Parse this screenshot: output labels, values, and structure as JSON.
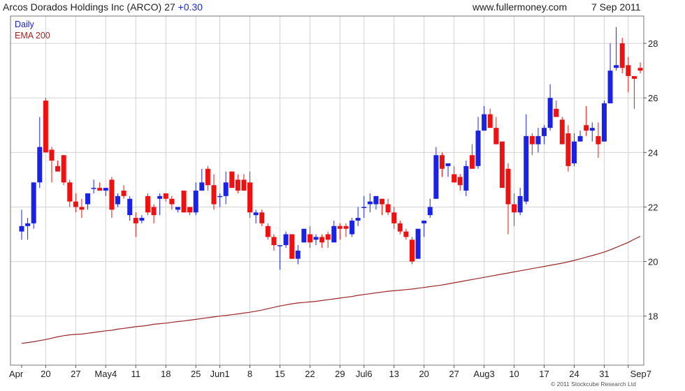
{
  "header": {
    "title": "Arcos Dorados Holdings Inc (ARCO) 27",
    "change": "+0.30",
    "website": "www.fullermoney.com",
    "date": "7 Sep 2011"
  },
  "legend": {
    "daily": "Daily",
    "ema": "EMA 200"
  },
  "copyright": "© 2011 Stockcube Research Ltd",
  "colors": {
    "up": "#1a22e6",
    "down": "#ee1111",
    "ema": "#9c2626",
    "grid": "#d2d2d2",
    "axis": "#555555"
  },
  "chart_data": {
    "type": "candlestick",
    "ylim": [
      16.2,
      29.0
    ],
    "yticks": [
      18,
      20,
      22,
      24,
      26,
      28
    ],
    "grid": true,
    "legend_position": "top-left",
    "x_tick_labels": [
      "Apr",
      "20",
      "27",
      "May4",
      "11",
      "18",
      "25",
      "Jun1",
      "8",
      "15",
      "22",
      "29",
      "Jul6",
      "13",
      "20",
      "27",
      "Aug3",
      "10",
      "17",
      "24",
      "31",
      "Sep7"
    ],
    "dates": [
      "Apr 14",
      "Apr 15",
      "Apr 18",
      "Apr 19",
      "Apr 20",
      "Apr 21",
      "Apr 22",
      "Apr 25",
      "Apr 26",
      "Apr 27",
      "Apr 28",
      "Apr 29",
      "May 2",
      "May 3",
      "May 4",
      "May 5",
      "May 6",
      "May 9",
      "May 10",
      "May 11",
      "May 12",
      "May 13",
      "May 16",
      "May 17",
      "May 18",
      "May 19",
      "May 20",
      "May 23",
      "May 24",
      "May 25",
      "May 26",
      "May 27",
      "May 31",
      "Jun 1",
      "Jun 2",
      "Jun 3",
      "Jun 6",
      "Jun 7",
      "Jun 8",
      "Jun 9",
      "Jun 10",
      "Jun 13",
      "Jun 14",
      "Jun 15",
      "Jun 16",
      "Jun 17",
      "Jun 20",
      "Jun 21",
      "Jun 22",
      "Jun 23",
      "Jun 24",
      "Jun 27",
      "Jun 28",
      "Jun 29",
      "Jun 30",
      "Jul 1",
      "Jul 5",
      "Jul 6",
      "Jul 7",
      "Jul 8",
      "Jul 11",
      "Jul 12",
      "Jul 13",
      "Jul 14",
      "Jul 15",
      "Jul 18",
      "Jul 19",
      "Jul 20",
      "Jul 21",
      "Jul 22",
      "Jul 25",
      "Jul 26",
      "Jul 27",
      "Jul 28",
      "Jul 29",
      "Aug 1",
      "Aug 2",
      "Aug 3",
      "Aug 4",
      "Aug 5",
      "Aug 8",
      "Aug 9",
      "Aug 10",
      "Aug 11",
      "Aug 12",
      "Aug 15",
      "Aug 16",
      "Aug 17",
      "Aug 18",
      "Aug 19",
      "Aug 22",
      "Aug 23",
      "Aug 24",
      "Aug 25",
      "Aug 26",
      "Aug 29",
      "Aug 30",
      "Aug 31",
      "Sep 1",
      "Sep 2",
      "Sep 6",
      "Sep 7"
    ],
    "ohlc": [
      [
        21.1,
        21.9,
        20.8,
        21.3
      ],
      [
        21.3,
        21.6,
        20.8,
        21.4
      ],
      [
        21.4,
        22.9,
        21.2,
        22.9
      ],
      [
        22.9,
        25.3,
        22.7,
        24.2
      ],
      [
        25.9,
        26.0,
        24.0,
        24.0
      ],
      [
        24.1,
        24.2,
        22.9,
        23.7
      ],
      [
        23.5,
        23.7,
        23.3,
        23.3
      ],
      [
        23.9,
        23.9,
        22.8,
        22.9
      ],
      [
        22.9,
        23.0,
        22.0,
        22.2
      ],
      [
        22.2,
        22.5,
        21.8,
        22.0
      ],
      [
        22.0,
        22.3,
        21.6,
        21.9
      ],
      [
        22.1,
        22.5,
        21.9,
        22.5
      ],
      [
        22.7,
        23.0,
        22.5,
        22.7
      ],
      [
        22.7,
        22.9,
        22.6,
        22.6
      ],
      [
        22.6,
        22.7,
        22.4,
        22.7
      ],
      [
        23.0,
        23.1,
        21.6,
        21.9
      ],
      [
        22.1,
        22.5,
        22.0,
        22.4
      ],
      [
        22.6,
        22.8,
        22.3,
        22.4
      ],
      [
        21.7,
        22.4,
        21.5,
        22.3
      ],
      [
        21.6,
        21.8,
        20.9,
        21.4
      ],
      [
        21.5,
        21.7,
        21.4,
        21.6
      ],
      [
        22.4,
        22.5,
        21.7,
        21.8
      ],
      [
        22.0,
        22.1,
        21.4,
        21.7
      ],
      [
        22.3,
        22.5,
        21.7,
        22.4
      ],
      [
        22.5,
        22.5,
        22.2,
        22.3
      ],
      [
        22.3,
        22.4,
        21.9,
        22.1
      ],
      [
        21.9,
        22.0,
        21.8,
        22.0
      ],
      [
        22.6,
        22.6,
        21.8,
        21.8
      ],
      [
        22.0,
        22.0,
        21.7,
        21.8
      ],
      [
        21.8,
        22.9,
        21.7,
        22.6
      ],
      [
        22.6,
        23.4,
        22.6,
        22.9
      ],
      [
        23.4,
        23.5,
        22.6,
        22.8
      ],
      [
        22.8,
        23.2,
        21.9,
        22.1
      ],
      [
        22.4,
        22.5,
        22.0,
        22.4
      ],
      [
        22.4,
        23.3,
        22.1,
        22.9
      ],
      [
        23.3,
        23.3,
        22.7,
        22.7
      ],
      [
        23.0,
        23.2,
        22.5,
        22.6
      ],
      [
        23.0,
        23.2,
        22.6,
        22.6
      ],
      [
        22.9,
        23.3,
        21.6,
        21.8
      ],
      [
        21.7,
        21.9,
        21.4,
        21.8
      ],
      [
        21.8,
        21.9,
        21.3,
        21.4
      ],
      [
        21.3,
        21.4,
        20.8,
        20.9
      ],
      [
        20.9,
        21.0,
        20.4,
        20.6
      ],
      [
        20.6,
        20.6,
        19.7,
        20.6
      ],
      [
        20.6,
        21.1,
        20.5,
        21.0
      ],
      [
        21.0,
        21.0,
        20.1,
        20.1
      ],
      [
        20.1,
        20.6,
        19.9,
        20.4
      ],
      [
        20.7,
        21.2,
        20.7,
        21.2
      ],
      [
        21.0,
        21.3,
        20.5,
        20.7
      ],
      [
        20.8,
        21.0,
        20.6,
        20.9
      ],
      [
        20.9,
        21.0,
        20.5,
        20.7
      ],
      [
        21.0,
        21.1,
        20.5,
        20.8
      ],
      [
        20.7,
        21.5,
        20.7,
        21.3
      ],
      [
        21.3,
        21.4,
        20.8,
        21.2
      ],
      [
        21.3,
        21.4,
        20.9,
        21.2
      ],
      [
        21.0,
        21.6,
        20.9,
        21.5
      ],
      [
        21.5,
        22.0,
        21.3,
        21.6
      ],
      [
        22.0,
        22.4,
        21.6,
        22.0
      ],
      [
        22.1,
        22.5,
        21.8,
        22.2
      ],
      [
        22.1,
        22.4,
        21.9,
        22.4
      ],
      [
        22.3,
        22.3,
        21.7,
        22.1
      ],
      [
        22.1,
        22.3,
        21.7,
        21.8
      ],
      [
        21.8,
        22.0,
        21.2,
        21.4
      ],
      [
        21.4,
        21.5,
        21.0,
        21.1
      ],
      [
        21.1,
        21.2,
        20.8,
        20.9
      ],
      [
        20.8,
        20.9,
        19.9,
        20.0
      ],
      [
        20.1,
        21.2,
        20.1,
        21.2
      ],
      [
        21.4,
        21.5,
        20.9,
        21.5
      ],
      [
        21.7,
        22.3,
        21.6,
        22.0
      ],
      [
        22.3,
        24.2,
        22.3,
        23.9
      ],
      [
        23.9,
        24.0,
        23.1,
        23.4
      ],
      [
        23.5,
        23.6,
        23.1,
        23.6
      ],
      [
        23.2,
        23.5,
        22.9,
        22.9
      ],
      [
        23.1,
        23.2,
        22.6,
        22.8
      ],
      [
        22.6,
        23.7,
        22.4,
        23.5
      ],
      [
        23.9,
        24.3,
        23.5,
        23.4
      ],
      [
        23.5,
        25.3,
        23.4,
        24.8
      ],
      [
        24.8,
        25.7,
        24.8,
        25.4
      ],
      [
        25.4,
        25.6,
        24.9,
        24.9
      ],
      [
        24.9,
        25.3,
        24.3,
        24.3
      ],
      [
        24.4,
        24.4,
        22.8,
        22.7
      ],
      [
        23.4,
        23.6,
        21.0,
        22.1
      ],
      [
        22.1,
        22.5,
        21.3,
        21.8
      ],
      [
        21.8,
        22.7,
        21.7,
        22.4
      ],
      [
        22.2,
        25.4,
        22.1,
        24.6
      ],
      [
        24.6,
        24.7,
        23.9,
        24.3
      ],
      [
        24.3,
        24.9,
        24.0,
        24.6
      ],
      [
        24.6,
        25.0,
        24.3,
        24.9
      ],
      [
        24.9,
        26.5,
        24.8,
        26.0
      ],
      [
        25.6,
        25.9,
        25.3,
        25.3
      ],
      [
        25.2,
        25.3,
        24.3,
        24.3
      ],
      [
        24.7,
        25.0,
        23.3,
        23.5
      ],
      [
        23.6,
        24.7,
        23.5,
        24.4
      ],
      [
        24.4,
        24.8,
        24.4,
        24.6
      ],
      [
        25.0,
        25.7,
        24.6,
        24.8
      ],
      [
        24.8,
        25.1,
        24.4,
        24.9
      ],
      [
        24.6,
        25.1,
        23.8,
        24.3
      ],
      [
        24.4,
        25.9,
        24.4,
        25.8
      ],
      [
        25.8,
        28.0,
        25.9,
        27.0
      ],
      [
        27.1,
        28.6,
        27.0,
        27.2
      ],
      [
        28.0,
        28.2,
        26.9,
        27.1
      ],
      [
        27.2,
        27.5,
        26.2,
        26.8
      ],
      [
        26.8,
        26.8,
        25.6,
        26.7
      ],
      [
        27.1,
        27.3,
        26.9,
        27.0
      ]
    ],
    "ema200": [
      17.0,
      17.03,
      17.06,
      17.1,
      17.14,
      17.19,
      17.24,
      17.28,
      17.31,
      17.33,
      17.34,
      17.37,
      17.4,
      17.43,
      17.46,
      17.48,
      17.52,
      17.55,
      17.58,
      17.61,
      17.63,
      17.66,
      17.7,
      17.72,
      17.74,
      17.77,
      17.8,
      17.82,
      17.85,
      17.88,
      17.91,
      17.94,
      17.97,
      18.0,
      18.02,
      18.05,
      18.08,
      18.11,
      18.14,
      18.18,
      18.22,
      18.27,
      18.32,
      18.37,
      18.41,
      18.45,
      18.48,
      18.5,
      18.52,
      18.54,
      18.57,
      18.6,
      18.63,
      18.66,
      18.69,
      18.72,
      18.76,
      18.79,
      18.82,
      18.85,
      18.88,
      18.91,
      18.93,
      18.95,
      18.97,
      18.99,
      19.02,
      19.05,
      19.08,
      19.11,
      19.14,
      19.18,
      19.22,
      19.26,
      19.3,
      19.34,
      19.38,
      19.42,
      19.46,
      19.5,
      19.54,
      19.58,
      19.62,
      19.66,
      19.7,
      19.74,
      19.78,
      19.82,
      19.86,
      19.9,
      19.94,
      19.99,
      20.04,
      20.1,
      20.16,
      20.22,
      20.28,
      20.35,
      20.43,
      20.52,
      20.61,
      20.7,
      20.82,
      20.92
    ]
  }
}
